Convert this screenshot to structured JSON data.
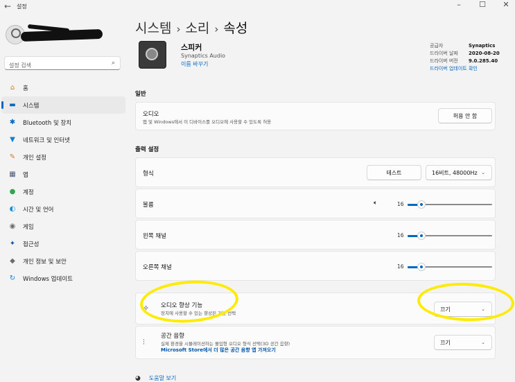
{
  "window": {
    "title": "설정",
    "back": "←",
    "minimize": "–",
    "maximize": "☐",
    "close": "✕"
  },
  "sidebar": {
    "search_placeholder": "설정 검색",
    "items": [
      {
        "label": "홈",
        "icon": "home-icon",
        "glyph": "⌂",
        "color": "#e07b00"
      },
      {
        "label": "시스템",
        "icon": "monitor-icon",
        "glyph": "▬",
        "color": "#0067c0"
      },
      {
        "label": "Bluetooth 및 장치",
        "icon": "bluetooth-icon",
        "glyph": "✱",
        "color": "#0067c0"
      },
      {
        "label": "네트워크 및 인터넷",
        "icon": "wifi-icon",
        "glyph": "▼",
        "color": "#0a7fd6"
      },
      {
        "label": "개인 설정",
        "icon": "brush-icon",
        "glyph": "✎",
        "color": "#d87a1c"
      },
      {
        "label": "앱",
        "icon": "apps-icon",
        "glyph": "▦",
        "color": "#4a5a78"
      },
      {
        "label": "계정",
        "icon": "person-icon",
        "glyph": "●",
        "color": "#2ea84a"
      },
      {
        "label": "시간 및 언어",
        "icon": "globe-icon",
        "glyph": "◐",
        "color": "#1a8fd6"
      },
      {
        "label": "게임",
        "icon": "gamepad-icon",
        "glyph": "◉",
        "color": "#6b6b6b"
      },
      {
        "label": "접근성",
        "icon": "accessibility-icon",
        "glyph": "✦",
        "color": "#0a5db5"
      },
      {
        "label": "개인 정보 및 보안",
        "icon": "shield-icon",
        "glyph": "◆",
        "color": "#6b6b6b"
      },
      {
        "label": "Windows 업데이트",
        "icon": "update-icon",
        "glyph": "↻",
        "color": "#0a7fd6"
      }
    ]
  },
  "breadcrumb": {
    "part1": "시스템",
    "sep": "›",
    "part2": "소리",
    "current": "속성"
  },
  "device": {
    "name": "스피커",
    "vendor": "Synaptics Audio",
    "rename": "이름 바꾸기",
    "meta": [
      {
        "key": "공급자",
        "value": "Synaptics"
      },
      {
        "key": "드라이버 날짜",
        "value": "2020-08-20"
      },
      {
        "key": "드라이버 버전",
        "value": "9.0.285.40"
      }
    ],
    "update_link": "드라이버 업데이트 확인"
  },
  "general": {
    "title": "일반",
    "audio_label": "오디오",
    "audio_desc": "앱 및 Windows에서 이 디바이스를 오디오에 사용할 수 있도록 허용",
    "audio_button": "허용 안 함"
  },
  "output": {
    "title": "출력 설정",
    "format_label": "형식",
    "test_button": "테스트",
    "format_value": "16비트, 48000Hz",
    "volume_label": "볼륨",
    "volume_value": "16",
    "volume_level": 0.16,
    "left_label": "왼쪽 채널",
    "left_value": "16",
    "left_level": 0.16,
    "right_label": "오른쪽 채널",
    "right_value": "16",
    "right_level": 0.16
  },
  "enhancements": {
    "label": "오디오 향상 기능",
    "desc": "장치에 사용할 수 있는 향상된 기능 선택",
    "value": "끄기"
  },
  "spatial": {
    "label": "공간 음향",
    "desc": "실제 환경을 시뮬레이션하는 몰입형 오디오 형식 선택(3D 공간 음향)",
    "store_link": "Microsoft Store에서 더 많은 공간 음향 앱 가져오기",
    "value": "끄기"
  },
  "help": {
    "label": "도움말 보기"
  },
  "colors": {
    "accent": "#0067c0",
    "highlight": "#ffeb00"
  }
}
